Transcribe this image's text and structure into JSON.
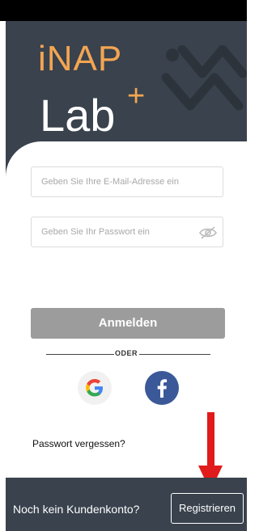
{
  "app": {
    "logo_top": "iNAP",
    "logo_bottom": "Lab",
    "logo_plus": "+"
  },
  "login": {
    "email_placeholder": "Geben Sie Ihre E-Mail-Adresse ein",
    "email_value": "",
    "password_placeholder": "Geben Sie Ihr Passwort ein",
    "password_value": "",
    "submit_label": "Anmelden",
    "divider_label": "ODER",
    "forgot_label": "Passwort vergessen?"
  },
  "social": {
    "google_icon": "google-g-icon",
    "facebook_icon": "facebook-f-icon"
  },
  "footer": {
    "prompt": "Noch kein Kundenkonto?",
    "register_label": "Registrieren"
  },
  "colors": {
    "brand_dark": "#39424d",
    "brand_orange": "#f3a552",
    "button_disabled": "#9c9c9c",
    "facebook": "#3b5998",
    "arrow_red": "#e11b1b"
  }
}
